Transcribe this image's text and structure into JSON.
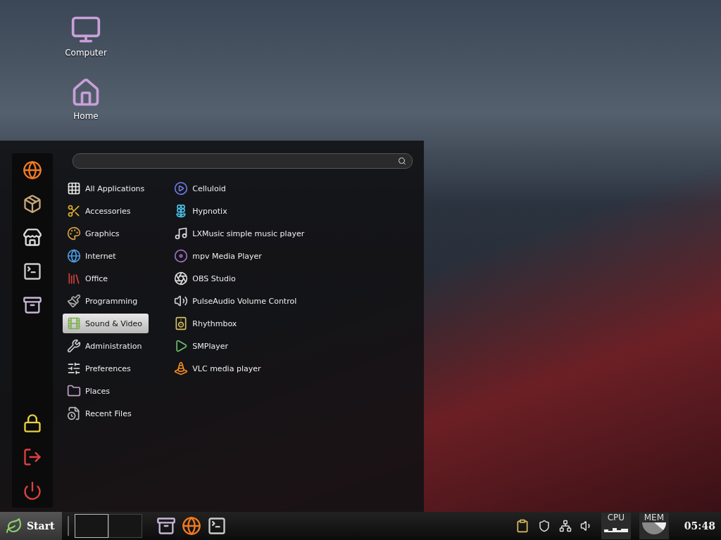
{
  "desktop": {
    "icons": [
      {
        "label": "Computer"
      },
      {
        "label": "Home"
      }
    ]
  },
  "menu": {
    "categories": [
      {
        "label": "All Applications",
        "selected": false
      },
      {
        "label": "Accessories",
        "selected": false
      },
      {
        "label": "Graphics",
        "selected": false
      },
      {
        "label": "Internet",
        "selected": false
      },
      {
        "label": "Office",
        "selected": false
      },
      {
        "label": "Programming",
        "selected": false
      },
      {
        "label": "Sound & Video",
        "selected": true
      },
      {
        "label": "Administration",
        "selected": false
      },
      {
        "label": "Preferences",
        "selected": false
      },
      {
        "label": "Places",
        "selected": false
      },
      {
        "label": "Recent Files",
        "selected": false
      }
    ],
    "apps": [
      {
        "label": "Celluloid"
      },
      {
        "label": "Hypnotix"
      },
      {
        "label": "LXMusic simple music player"
      },
      {
        "label": "mpv Media Player"
      },
      {
        "label": "OBS Studio"
      },
      {
        "label": "PulseAudio Volume Control"
      },
      {
        "label": "Rhythmbox"
      },
      {
        "label": "SMPlayer"
      },
      {
        "label": "VLC media player"
      }
    ]
  },
  "taskbar": {
    "start": "Start",
    "workspaces": [
      {
        "selected": true
      },
      {
        "selected": false
      }
    ],
    "cpu": "CPU",
    "mem": "MEM",
    "clock": "05:48"
  }
}
